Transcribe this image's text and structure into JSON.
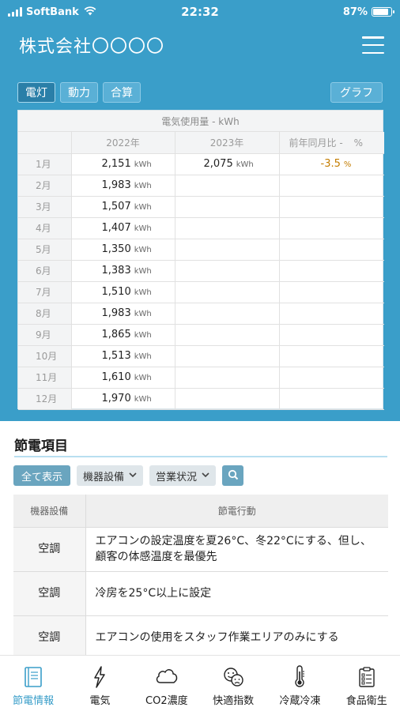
{
  "status_bar": {
    "carrier": "SoftBank",
    "time": "22:32",
    "battery": "87%",
    "battery_level": 0.87
  },
  "app": {
    "title": "株式会社〇〇〇〇"
  },
  "tabs": [
    {
      "label": "電灯",
      "active": true
    },
    {
      "label": "動力",
      "active": false
    },
    {
      "label": "合算",
      "active": false
    }
  ],
  "graph_button": "グラフ",
  "usage_table": {
    "caption": "電気使用量 - kWh",
    "col_2022": "2022年",
    "col_2023": "2023年",
    "col_ratio": "前年同月比 -",
    "col_ratio_unit": "%",
    "unit": "kWh",
    "pct": "%",
    "rows": [
      {
        "month": "1月",
        "y2022": "2,151",
        "y2023": "2,075",
        "ratio": "-3.5"
      },
      {
        "month": "2月",
        "y2022": "1,983",
        "y2023": "",
        "ratio": ""
      },
      {
        "month": "3月",
        "y2022": "1,507",
        "y2023": "",
        "ratio": ""
      },
      {
        "month": "4月",
        "y2022": "1,407",
        "y2023": "",
        "ratio": ""
      },
      {
        "month": "5月",
        "y2022": "1,350",
        "y2023": "",
        "ratio": ""
      },
      {
        "month": "6月",
        "y2022": "1,383",
        "y2023": "",
        "ratio": ""
      },
      {
        "month": "7月",
        "y2022": "1,510",
        "y2023": "",
        "ratio": ""
      },
      {
        "month": "8月",
        "y2022": "1,983",
        "y2023": "",
        "ratio": ""
      },
      {
        "month": "9月",
        "y2022": "1,865",
        "y2023": "",
        "ratio": ""
      },
      {
        "month": "10月",
        "y2022": "1,513",
        "y2023": "",
        "ratio": ""
      },
      {
        "month": "11月",
        "y2022": "1,610",
        "y2023": "",
        "ratio": ""
      },
      {
        "month": "12月",
        "y2022": "1,970",
        "y2023": "",
        "ratio": ""
      }
    ]
  },
  "savings": {
    "title": "節電項目",
    "show_all": "全て表示",
    "filter_equipment": "機器設備",
    "filter_status": "営業状況",
    "col_equipment": "機器設備",
    "col_action": "節電行動",
    "rows": [
      {
        "equipment": "空調",
        "action": "エアコンの設定温度を夏26°C、冬22°Cにする、但し、顧客の体感温度を最優先"
      },
      {
        "equipment": "空調",
        "action": "冷房を25°C以上に設定"
      },
      {
        "equipment": "空調",
        "action": "エアコンの使用をスタッフ作業エリアのみにする"
      }
    ]
  },
  "bottom_nav": [
    {
      "label": "節電情報",
      "icon": "book-icon",
      "active": true
    },
    {
      "label": "電気",
      "icon": "lightning-icon",
      "active": false
    },
    {
      "label": "CO2濃度",
      "icon": "cloud-icon",
      "active": false
    },
    {
      "label": "快適指数",
      "icon": "face-icon",
      "active": false
    },
    {
      "label": "冷蔵冷凍",
      "icon": "thermometer-icon",
      "active": false
    },
    {
      "label": "食品衛生",
      "icon": "clipboard-icon",
      "active": false
    }
  ],
  "colors": {
    "brand": "#3a9ec9",
    "accent_text": "#c47d00"
  }
}
